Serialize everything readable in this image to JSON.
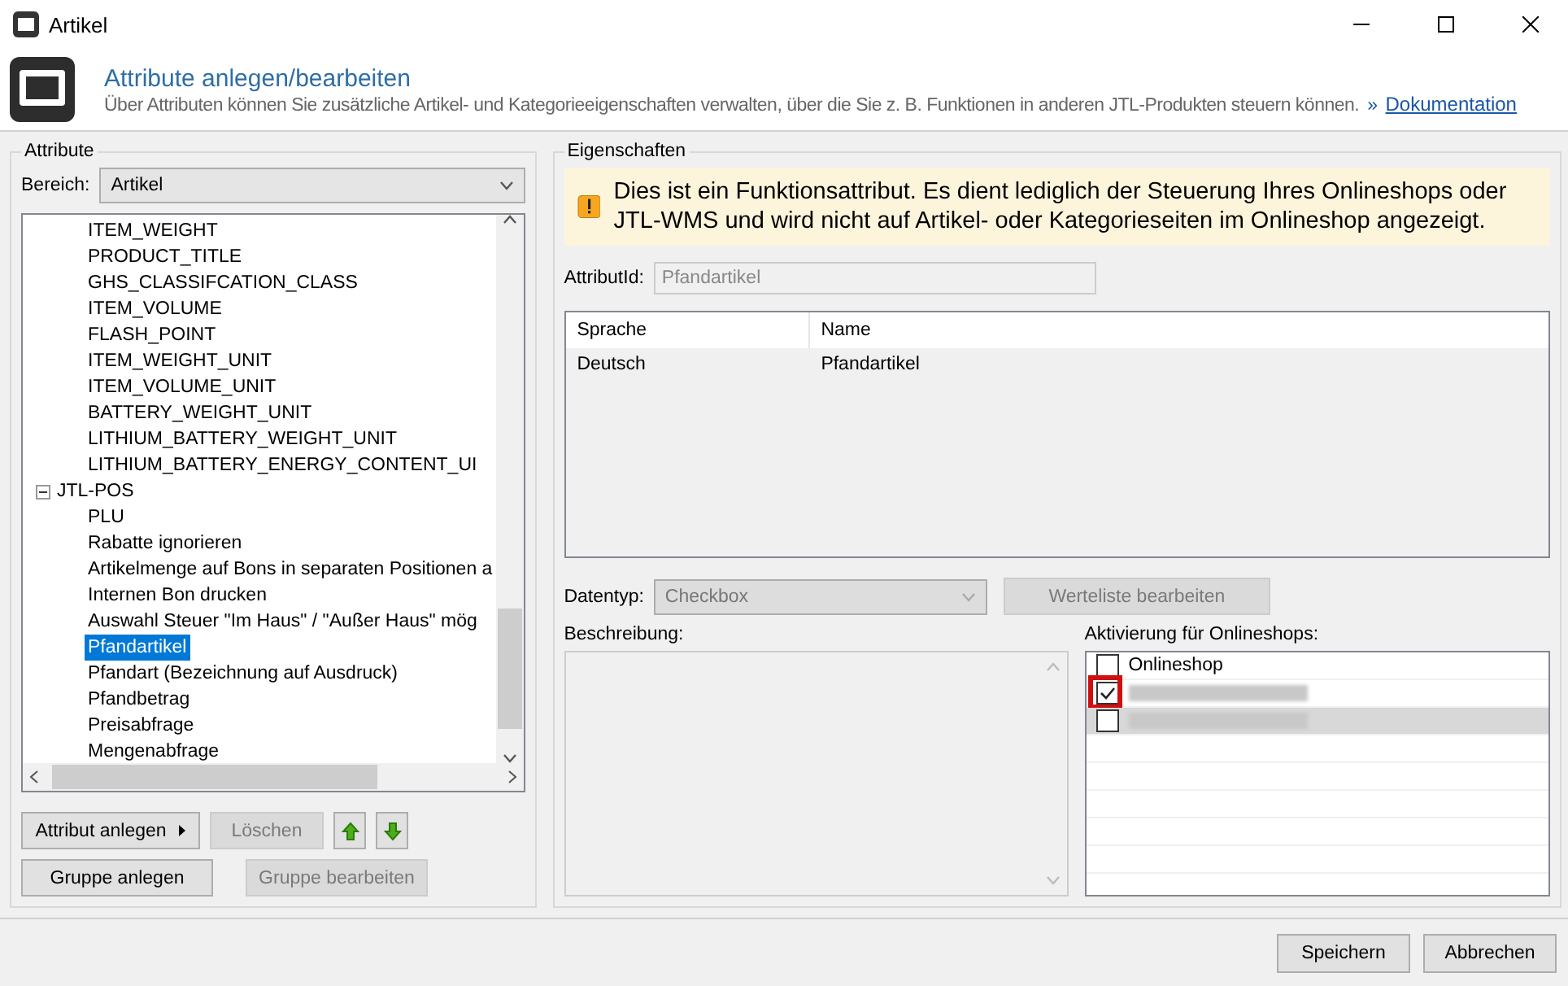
{
  "window": {
    "title": "Artikel"
  },
  "header": {
    "title": "Attribute anlegen/bearbeiten",
    "description": "Über Attributen können Sie zusätzliche Artikel- und Kategorieeigenschaften verwalten, über die Sie z. B. Funktionen in anderen JTL-Produkten steuern können.",
    "link_prefix": "»",
    "link": "Dokumentation"
  },
  "attributes": {
    "title": "Attribute",
    "bereich_label": "Bereich:",
    "bereich_value": "Artikel",
    "tree": [
      {
        "children": [
          {
            "label": "ITEM_WEIGHT",
            "selected": false
          },
          {
            "label": "PRODUCT_TITLE",
            "selected": false
          },
          {
            "label": "GHS_CLASSIFCATION_CLASS",
            "selected": false
          },
          {
            "label": "ITEM_VOLUME",
            "selected": false
          },
          {
            "label": "FLASH_POINT",
            "selected": false
          },
          {
            "label": "ITEM_WEIGHT_UNIT",
            "selected": false
          },
          {
            "label": "ITEM_VOLUME_UNIT",
            "selected": false
          },
          {
            "label": "BATTERY_WEIGHT_UNIT",
            "selected": false
          },
          {
            "label": "LITHIUM_BATTERY_WEIGHT_UNIT",
            "selected": false
          },
          {
            "label": "LITHIUM_BATTERY_ENERGY_CONTENT_UI",
            "selected": false
          }
        ]
      },
      {
        "label": "JTL-POS",
        "expanded": true,
        "children": [
          {
            "label": "PLU",
            "selected": false
          },
          {
            "label": "Rabatte ignorieren",
            "selected": false
          },
          {
            "label": "Artikelmenge auf Bons in separaten Positionen a",
            "selected": false
          },
          {
            "label": "Internen Bon drucken",
            "selected": false
          },
          {
            "label": "Auswahl Steuer \"Im Haus\" / \"Außer Haus\" mög",
            "selected": false
          },
          {
            "label": "Pfandartikel",
            "selected": true
          },
          {
            "label": "Pfandart (Bezeichnung auf Ausdruck)",
            "selected": false
          },
          {
            "label": "Pfandbetrag",
            "selected": false
          },
          {
            "label": "Preisabfrage",
            "selected": false
          },
          {
            "label": "Mengenabfrage",
            "selected": false
          }
        ]
      }
    ],
    "buttons": [
      {
        "label": "Attribut anlegen",
        "kind": "menu",
        "disabled": false
      },
      {
        "label": "Löschen",
        "kind": "plain",
        "disabled": true
      },
      {
        "kind": "up",
        "disabled": false
      },
      {
        "kind": "down",
        "disabled": false
      }
    ],
    "group_buttons": [
      {
        "label": "Gruppe anlegen",
        "disabled": false
      },
      {
        "label": "Gruppe bearbeiten",
        "disabled": true
      }
    ]
  },
  "properties": {
    "title": "Eigenschaften",
    "notice": "Dies ist ein Funktionsattribut. Es dient lediglich der Steuerung Ihres Onlineshops oder JTL-WMS und wird nicht auf Artikel- oder Kategorieseiten im Onlineshop angezeigt.",
    "attribut_id_label": "AttributId:",
    "attribut_id_value": "Pfandartikel",
    "table": {
      "columns": [
        "Sprache",
        "Name"
      ],
      "rows": [
        [
          "Deutsch",
          "Pfandartikel"
        ]
      ]
    },
    "datentyp_label": "Datentyp:",
    "datentyp_value": "Checkbox",
    "werteliste_button": "Werteliste bearbeiten",
    "beschreibung_label": "Beschreibung:",
    "shops_label": "Aktivierung für Onlineshops:",
    "shops": [
      {
        "kind": "named",
        "label": "Onlineshop",
        "checked": false,
        "selected": false,
        "highlighted": false
      },
      {
        "kind": "redacted",
        "checked": true,
        "selected": false,
        "highlighted": true
      },
      {
        "kind": "redacted",
        "checked": false,
        "selected": true,
        "highlighted": false
      }
    ]
  },
  "footer": {
    "buttons": [
      "Speichern",
      "Abbrechen"
    ]
  }
}
